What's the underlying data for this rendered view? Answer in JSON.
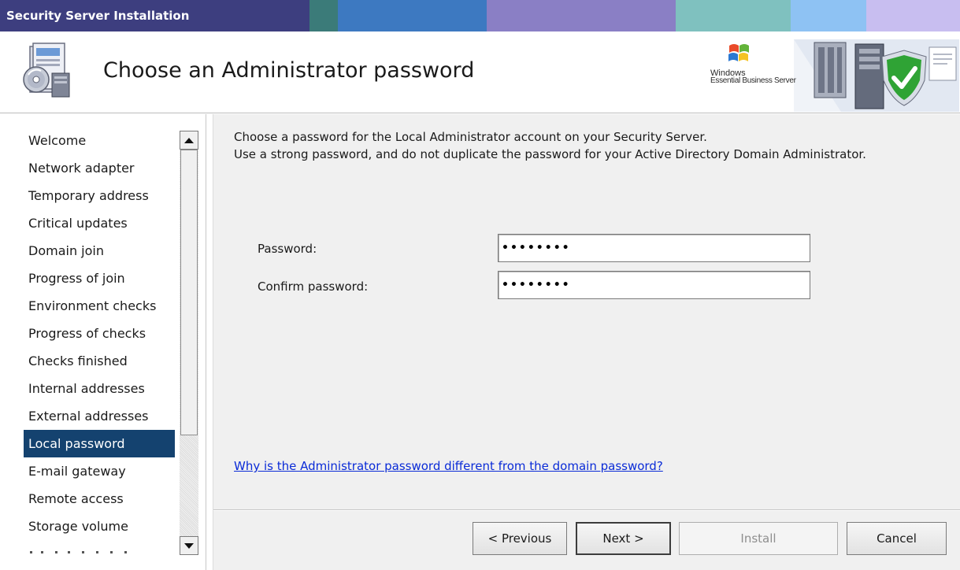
{
  "window": {
    "title": "Security Server Installation",
    "title_bar_colors": [
      "#3d3e7f",
      "#3b7b79",
      "#3d79c1",
      "#8a7fc5",
      "#7fc1bf",
      "#8ec2f3",
      "#c8bef0"
    ]
  },
  "header": {
    "page_title": "Choose an Administrator password",
    "brand_line1": "Windows",
    "brand_line2": "Essential Business Server"
  },
  "sidebar": {
    "items": [
      {
        "label": "Welcome"
      },
      {
        "label": "Network adapter"
      },
      {
        "label": "Temporary address"
      },
      {
        "label": "Critical updates"
      },
      {
        "label": "Domain join"
      },
      {
        "label": "Progress of join"
      },
      {
        "label": "Environment checks"
      },
      {
        "label": "Progress of checks"
      },
      {
        "label": "Checks finished"
      },
      {
        "label": "Internal addresses"
      },
      {
        "label": "External addresses"
      },
      {
        "label": "Local password",
        "active": true
      },
      {
        "label": "E-mail gateway"
      },
      {
        "label": "Remote access"
      },
      {
        "label": "Storage volume"
      }
    ],
    "selected_color": "#14426f"
  },
  "main": {
    "intro_line1": "Choose a password for the Local Administrator account on your Security Server.",
    "intro_line2": "Use a strong password, and do not duplicate the password for your Active Directory Domain Administrator.",
    "password_label": "Password:",
    "password_value": "••••••••",
    "confirm_label": "Confirm password:",
    "confirm_value": "••••••••",
    "help_link": "Why is the Administrator password different from the domain password?",
    "link_color": "#0a2bd7"
  },
  "buttons": {
    "previous": "< Previous",
    "next": "Next >",
    "install": "Install",
    "cancel": "Cancel"
  }
}
